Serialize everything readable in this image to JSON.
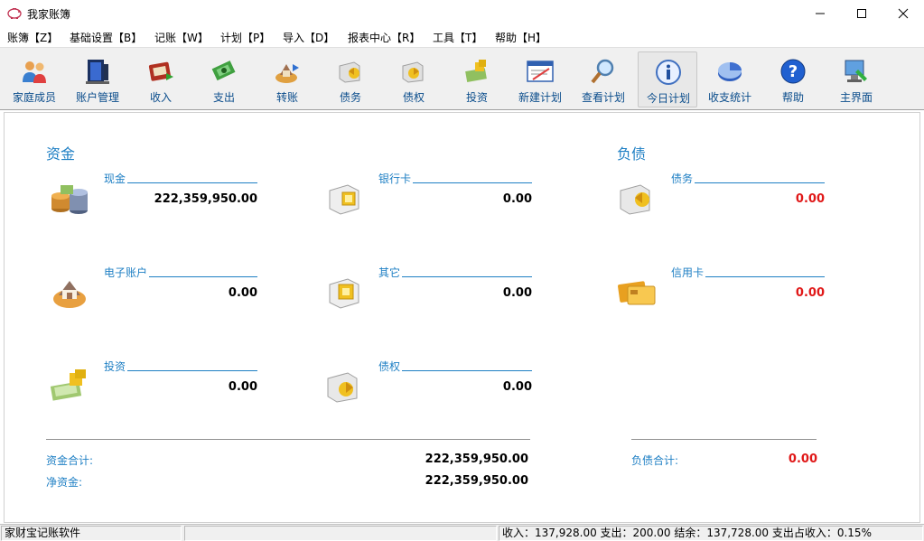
{
  "window": {
    "title": "我家账簿"
  },
  "menu": [
    {
      "label": "账簿【Z】"
    },
    {
      "label": "基础设置【B】"
    },
    {
      "label": "记账【W】"
    },
    {
      "label": "计划【P】"
    },
    {
      "label": "导入【D】"
    },
    {
      "label": "报表中心【R】"
    },
    {
      "label": "工具【T】"
    },
    {
      "label": "帮助【H】"
    }
  ],
  "toolbar": [
    {
      "label": "家庭成员",
      "icon": "family-members-icon"
    },
    {
      "label": "账户管理",
      "icon": "account-manage-icon"
    },
    {
      "label": "收入",
      "icon": "income-icon"
    },
    {
      "label": "支出",
      "icon": "expense-icon"
    },
    {
      "label": "转账",
      "icon": "transfer-icon"
    },
    {
      "label": "债务",
      "icon": "debt-icon"
    },
    {
      "label": "债权",
      "icon": "credit-icon"
    },
    {
      "label": "投资",
      "icon": "investment-icon"
    },
    {
      "label": "新建计划",
      "icon": "new-plan-icon"
    },
    {
      "label": "查看计划",
      "icon": "view-plan-icon"
    },
    {
      "label": "今日计划",
      "icon": "today-plan-icon"
    },
    {
      "label": "收支统计",
      "icon": "statistics-icon"
    },
    {
      "label": "帮助",
      "icon": "help-icon"
    },
    {
      "label": "主界面",
      "icon": "main-screen-icon"
    }
  ],
  "assets": {
    "title": "资金",
    "items": [
      {
        "name": "现金",
        "value": "222,359,950.00",
        "icon": "cash-icon"
      },
      {
        "name": "银行卡",
        "value": "0.00",
        "icon": "bank-card-icon"
      },
      {
        "name": "电子账户",
        "value": "0.00",
        "icon": "e-account-icon"
      },
      {
        "name": "其它",
        "value": "0.00",
        "icon": "other-icon"
      },
      {
        "name": "投资",
        "value": "0.00",
        "icon": "investment-asset-icon"
      },
      {
        "name": "债权",
        "value": "0.00",
        "icon": "credit-asset-icon"
      }
    ],
    "total_label": "资金合计:",
    "total_value": "222,359,950.00",
    "net_label": "净资金:",
    "net_value": "222,359,950.00"
  },
  "liabilities": {
    "title": "负债",
    "items": [
      {
        "name": "债务",
        "value": "0.00",
        "icon": "debt-liability-icon"
      },
      {
        "name": "信用卡",
        "value": "0.00",
        "icon": "credit-card-icon"
      }
    ],
    "total_label": "负债合计:",
    "total_value": "0.00"
  },
  "status": {
    "app": "家财宝记账软件",
    "middle": "",
    "summary": "收入：137,928.00 支出：200.00 结余：137,728.00 支出占收入：0.15%"
  },
  "colors": {
    "accent": "#1e7fc4",
    "negative": "#e01818",
    "toolbar_text": "#0b4d8c"
  }
}
